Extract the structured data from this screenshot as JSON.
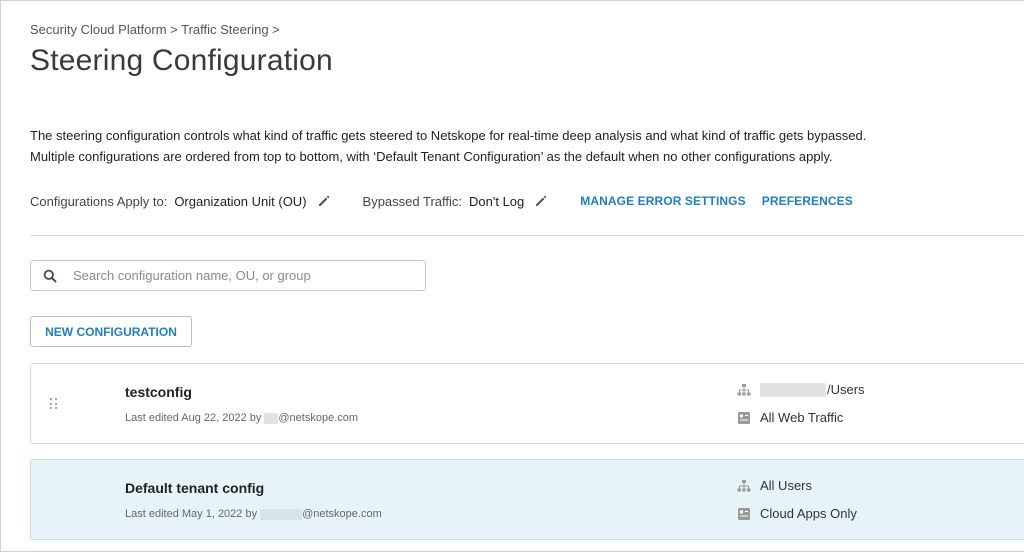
{
  "breadcrumb": {
    "text": "Security Cloud Platform > Traffic Steering >"
  },
  "page": {
    "title": "Steering Configuration",
    "description_line1": "The steering configuration controls what kind of traffic gets steered to Netskope for real-time deep analysis and what kind of traffic gets bypassed.",
    "description_line2": "Multiple configurations are ordered from top to bottom, with ‘Default Tenant Configuration’ as the default when no other configurations apply."
  },
  "settings": {
    "apply_label": "Configurations Apply to:",
    "apply_value": "Organization Unit (OU)",
    "bypass_label": "Bypassed Traffic:",
    "bypass_value": "Don't Log",
    "manage_error_link": "MANAGE ERROR SETTINGS",
    "preferences_link": "PREFERENCES"
  },
  "search": {
    "placeholder": "Search configuration name, OU, or group",
    "value": ""
  },
  "new_config_label": "NEW CONFIGURATION",
  "configs": [
    {
      "name": "testconfig",
      "meta_prefix": "Last edited Aug 22, 2022 by",
      "meta_suffix": "@netskope.com",
      "scope": "/Users",
      "traffic": "All Web Traffic"
    },
    {
      "name": "Default tenant config",
      "meta_prefix": "Last edited May 1, 2022 by",
      "meta_suffix": "@netskope.com",
      "scope": "All Users",
      "traffic": "Cloud Apps Only"
    }
  ],
  "colors": {
    "link": "#1f7fc2",
    "default_row_bg": "#e6f4fa"
  }
}
